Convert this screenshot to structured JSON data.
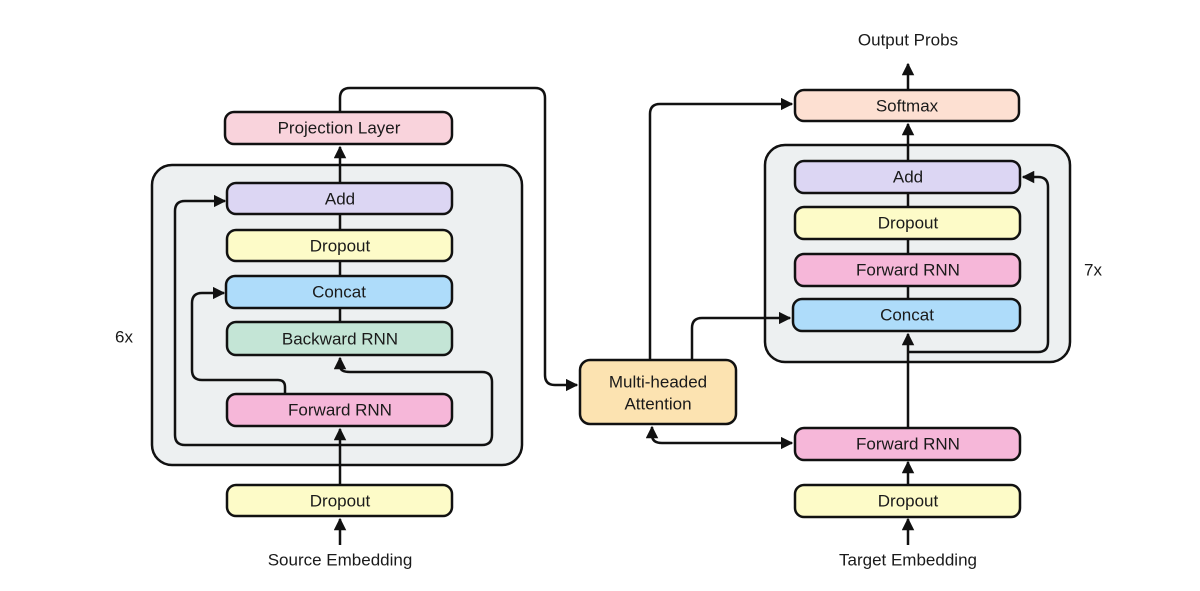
{
  "colors": {
    "projection": "#f9d3dc",
    "add": "#dcd6f3",
    "dropout": "#fdfbc8",
    "concat": "#aedcfa",
    "backward_rnn": "#c4e5d6",
    "forward_rnn": "#f6b7d9",
    "softmax": "#fde0d2",
    "attention": "#fce3b1",
    "container": "#edf0f1"
  },
  "encoder": {
    "input_label": "Source Embedding",
    "repeat_label": "6x",
    "dropout_in": "Dropout",
    "forward_rnn": "Forward RNN",
    "backward_rnn": "Backward RNN",
    "concat": "Concat",
    "dropout": "Dropout",
    "add": "Add",
    "projection": "Projection Layer"
  },
  "attention": {
    "line1": "Multi-headed",
    "line2": "Attention"
  },
  "decoder": {
    "input_label": "Target Embedding",
    "repeat_label": "7x",
    "dropout_in": "Dropout",
    "forward_rnn_in": "Forward RNN",
    "concat": "Concat",
    "forward_rnn": "Forward RNN",
    "dropout": "Dropout",
    "add": "Add",
    "softmax": "Softmax",
    "output_label": "Output Probs"
  }
}
